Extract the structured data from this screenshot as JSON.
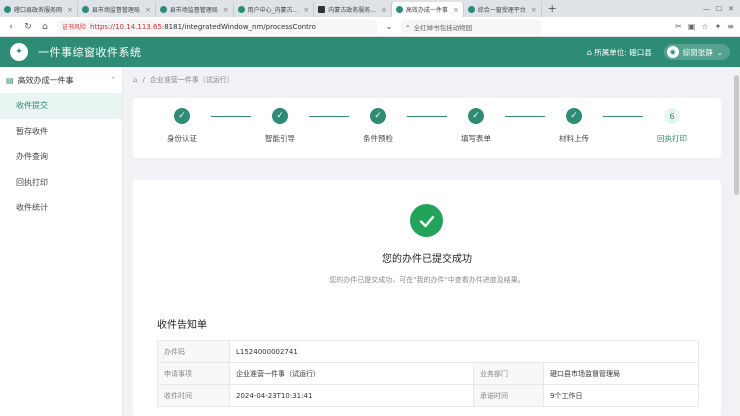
{
  "browser": {
    "tabs": [
      {
        "label": "磴口县政务服务网",
        "active": false
      },
      {
        "label": "县市场监督管理局",
        "active": false
      },
      {
        "label": "县市场监督管理局",
        "active": false
      },
      {
        "label": "用户中心_内蒙古...",
        "active": false
      },
      {
        "label": "内蒙古政务服务...",
        "active": false
      },
      {
        "label": "高效办成一件事",
        "active": true
      },
      {
        "label": "综合一窗受理平台",
        "active": false
      }
    ],
    "new_tab": "+",
    "security_warning": "证书风险",
    "url_host": "https://10.14.113.65",
    "url_rest": ":8181/integratedWindow_nm/processContro",
    "search_placeholder": "全红婵书包挂动物园"
  },
  "header": {
    "title": "一件事综窗收件系统",
    "unit_label": "所属单位:",
    "unit_value": "磴口县",
    "user_name": "综窗张静"
  },
  "sidebar": {
    "group_label": "高效办成一件事",
    "items": [
      {
        "label": "收件提交",
        "active": true
      },
      {
        "label": "暂存收件",
        "active": false
      },
      {
        "label": "办件查询",
        "active": false
      },
      {
        "label": "回执打印",
        "active": false
      },
      {
        "label": "收件统计",
        "active": false
      }
    ]
  },
  "breadcrumb": {
    "separator": "/",
    "current": "企业准营一件事（试运行）"
  },
  "steps": [
    {
      "label": "身份认证",
      "status": "done"
    },
    {
      "label": "智能引导",
      "status": "done"
    },
    {
      "label": "条件预检",
      "status": "done"
    },
    {
      "label": "填写表单",
      "status": "done"
    },
    {
      "label": "材料上传",
      "status": "done"
    },
    {
      "label": "回执打印",
      "status": "current",
      "number": "6"
    }
  ],
  "result": {
    "title": "您的办件已提交成功",
    "subtitle": "您的办件已提交成功，可在\"我的办件\"中查看办件进度及结果。",
    "notice_title": "收件告知单",
    "rows": {
      "code_label": "办件码",
      "code_value": "L1524000002741",
      "matter_label": "申请事项",
      "matter_value": "企业准营一件事（试运行）",
      "dept_label": "业务部门",
      "dept_value": "磴口县市场监督管理局",
      "time_label": "收件时间",
      "time_value": "2024-04-23T10:31:41",
      "limit_label": "承诺时间",
      "limit_value": "9个工作日"
    }
  },
  "colors": {
    "brand": "#2e8b74",
    "success": "#22a35a"
  }
}
